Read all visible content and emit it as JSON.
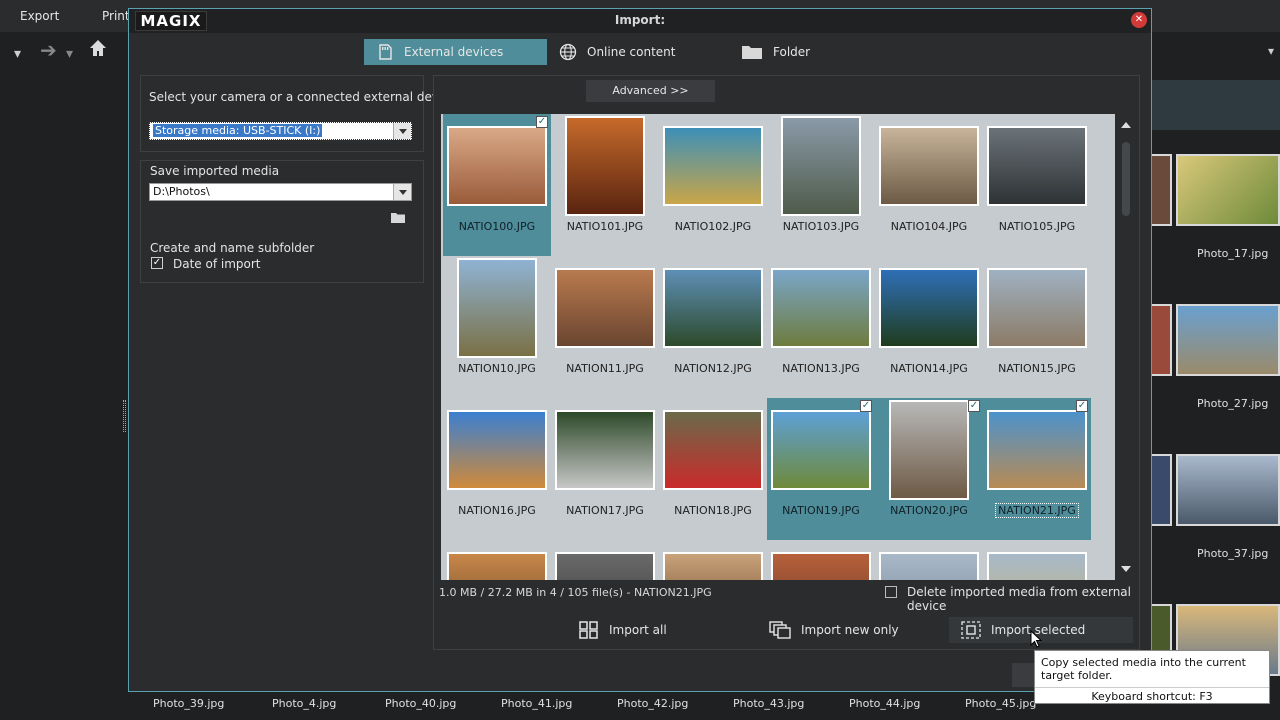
{
  "background": {
    "menu": [
      "Export",
      "Print"
    ],
    "right_labels": [
      "Photo_17.jpg",
      "Photo_27.jpg",
      "Photo_37.jpg"
    ],
    "bottom_labels": [
      "Photo_39.jpg",
      "Photo_4.jpg",
      "Photo_40.jpg",
      "Photo_41.jpg",
      "Photo_42.jpg",
      "Photo_43.jpg",
      "Photo_44.jpg",
      "Photo_45.jpg"
    ]
  },
  "dialog": {
    "logo": "MAGIX",
    "title": "Import:",
    "tabs": [
      {
        "label": "External devices",
        "active": true
      },
      {
        "label": "Online content",
        "active": false
      },
      {
        "label": "Folder",
        "active": false
      }
    ],
    "left": {
      "select_device_label": "Select your camera or a connected external device",
      "device_value": "Storage media: USB-STICK (I:)",
      "save_label": "Save imported media",
      "save_path": "D:\\Photos\\",
      "subfolder_label": "Create and name subfolder",
      "date_label": "Date of import",
      "date_checked": true
    },
    "advanced_label": "Advanced >>",
    "files": [
      {
        "name": "NATIO100.JPG",
        "selected": true,
        "colors": [
          "#d9a987",
          "#9a5b3b"
        ]
      },
      {
        "name": "NATIO101.JPG",
        "selected": false,
        "colors": [
          "#c66a2b",
          "#5a2410"
        ]
      },
      {
        "name": "NATIO102.JPG",
        "selected": false,
        "colors": [
          "#3d8fb8",
          "#c9a648"
        ]
      },
      {
        "name": "NATIO103.JPG",
        "selected": false,
        "colors": [
          "#8a9aa8",
          "#4f5b4a"
        ]
      },
      {
        "name": "NATIO104.JPG",
        "selected": false,
        "colors": [
          "#c7b49a",
          "#6d5a45"
        ]
      },
      {
        "name": "NATIO105.JPG",
        "selected": false,
        "colors": [
          "#6b7378",
          "#2e3235"
        ]
      },
      {
        "name": "NATION10.JPG",
        "selected": false,
        "colors": [
          "#8fb3d3",
          "#7a7045"
        ]
      },
      {
        "name": "NATION11.JPG",
        "selected": false,
        "colors": [
          "#b97a4e",
          "#6a4530"
        ]
      },
      {
        "name": "NATION12.JPG",
        "selected": false,
        "colors": [
          "#5e8fb6",
          "#2d4a2b"
        ]
      },
      {
        "name": "NATION13.JPG",
        "selected": false,
        "colors": [
          "#7aa6c9",
          "#6e7c3e"
        ]
      },
      {
        "name": "NATION14.JPG",
        "selected": false,
        "colors": [
          "#2f6fb7",
          "#1f3c1e"
        ]
      },
      {
        "name": "NATION15.JPG",
        "selected": false,
        "colors": [
          "#9fb1c2",
          "#8c7b66"
        ]
      },
      {
        "name": "NATION16.JPG",
        "selected": false,
        "colors": [
          "#3b7fd0",
          "#d08a3a"
        ]
      },
      {
        "name": "NATION17.JPG",
        "selected": false,
        "colors": [
          "#2e4a2a",
          "#c7c7c7"
        ]
      },
      {
        "name": "NATION18.JPG",
        "selected": false,
        "colors": [
          "#6a6a4a",
          "#c92b2b"
        ]
      },
      {
        "name": "NATION19.JPG",
        "selected": true,
        "colors": [
          "#5da0d6",
          "#6f8a3a"
        ]
      },
      {
        "name": "NATION20.JPG",
        "selected": true,
        "colors": [
          "#b8b8b8",
          "#6e5a45"
        ]
      },
      {
        "name": "NATION21.JPG",
        "selected": true,
        "colors": [
          "#4c92cc",
          "#b88b54"
        ]
      },
      {
        "name": "",
        "selected": false,
        "colors": [
          "#c8874a",
          "#6a4a2a"
        ]
      },
      {
        "name": "",
        "selected": false,
        "colors": [
          "#6a6a6a",
          "#3a3a3a"
        ]
      },
      {
        "name": "",
        "selected": false,
        "colors": [
          "#c9a27a",
          "#6a4a2a"
        ]
      },
      {
        "name": "",
        "selected": false,
        "colors": [
          "#b7603a",
          "#6a3a2a"
        ]
      },
      {
        "name": "",
        "selected": false,
        "colors": [
          "#a9b8c8",
          "#7a8a9a"
        ]
      },
      {
        "name": "",
        "selected": false,
        "colors": [
          "#a6b9c9",
          "#c9b27a"
        ]
      }
    ],
    "status": "1.0 MB / 27.2 MB in 4 / 105 file(s)   -   NATION21.JPG",
    "delete_label": "Delete imported media from external device",
    "actions": {
      "import_all": "Import all",
      "import_new": "Import new only",
      "import_selected": "Import selected"
    },
    "tooltip": {
      "text": "Copy selected media into the current target folder.",
      "shortcut": "Keyboard shortcut: F3"
    }
  }
}
